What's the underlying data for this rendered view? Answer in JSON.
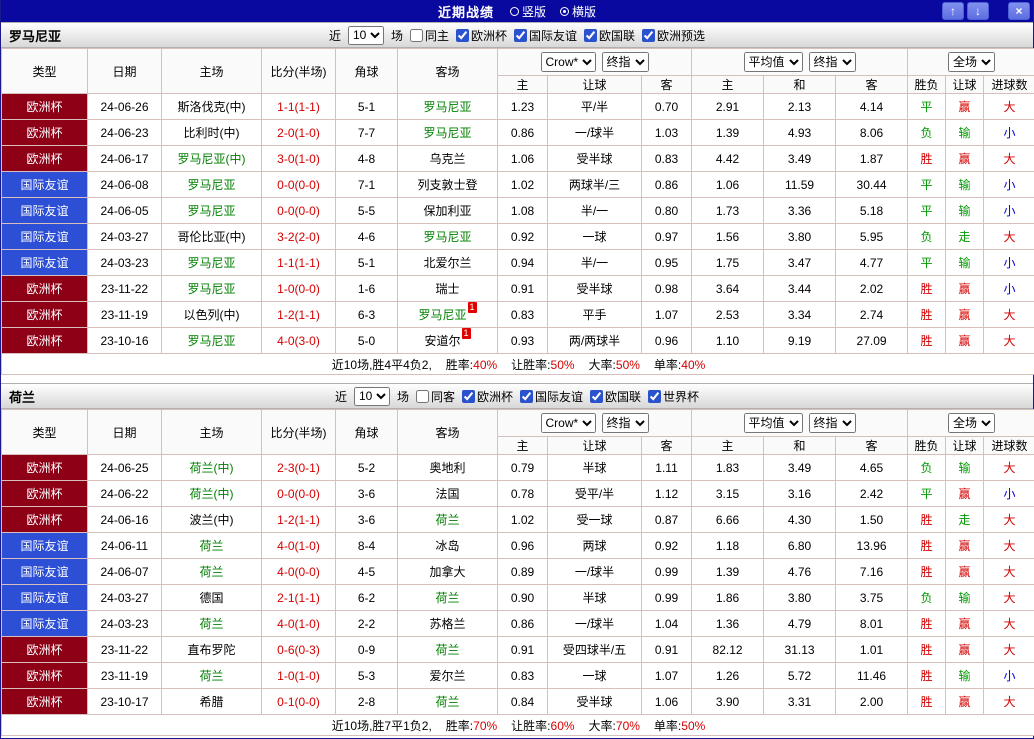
{
  "titlebar": {
    "title": "近期战绩",
    "radios": [
      {
        "label": "竖版",
        "selected": false
      },
      {
        "label": "横版",
        "selected": true
      }
    ],
    "buttons": {
      "up": "↑",
      "down": "↓",
      "close": "×"
    }
  },
  "filter_labels": {
    "near": "近",
    "games": "场"
  },
  "table_header": {
    "type": "类型",
    "date": "日期",
    "home": "主场",
    "score": "比分(半场)",
    "corner": "角球",
    "away": "客场",
    "ah_group": {
      "select1": "Crow*",
      "select2": "终指",
      "home": "主",
      "line": "让球",
      "away": "客"
    },
    "eu_group": {
      "select1": "平均值",
      "select2": "终指",
      "home": "主",
      "draw": "和",
      "away": "客"
    },
    "result_group": {
      "select": "全场",
      "wdl": "胜负",
      "handicap": "让球",
      "goals": "进球数"
    }
  },
  "colors": {
    "titlebar-bg": "#0909a0",
    "euro-bg": "#8d0016",
    "friendly-bg": "#2d4fd5",
    "focus-team": "#008000",
    "score-red": "#d40000",
    "result-red": "#d40000",
    "result-green": "#009900",
    "result-blue": "#0000d0",
    "grid-line": "#d9bebe",
    "button-bg": "#8090ee"
  },
  "sections": [
    {
      "team": "罗马尼亚",
      "filter": {
        "count": "10",
        "same_label": "同主",
        "same_checked": false,
        "competitions": [
          {
            "label": "欧洲杯",
            "checked": true
          },
          {
            "label": "国际友谊",
            "checked": true
          },
          {
            "label": "欧国联",
            "checked": true
          },
          {
            "label": "欧洲预选",
            "checked": true
          }
        ]
      },
      "rows": [
        {
          "type": "欧洲杯",
          "type_class": "euro",
          "date": "24-06-26",
          "home": {
            "name": "斯洛伐克(中)",
            "focus": false
          },
          "score": "1-1(1-1)",
          "corner": "5-1",
          "away": {
            "name": "罗马尼亚",
            "focus": true
          },
          "ah": [
            "1.23",
            "平/半",
            "0.70"
          ],
          "eu": [
            "2.91",
            "2.13",
            "4.14"
          ],
          "results": [
            {
              "t": "平",
              "c": "g"
            },
            {
              "t": "赢",
              "c": "r"
            },
            {
              "t": "大",
              "c": "r"
            }
          ]
        },
        {
          "type": "欧洲杯",
          "type_class": "euro",
          "date": "24-06-23",
          "home": {
            "name": "比利时(中)",
            "focus": false
          },
          "score": "2-0(1-0)",
          "corner": "7-7",
          "away": {
            "name": "罗马尼亚",
            "focus": true
          },
          "ah": [
            "0.86",
            "一/球半",
            "1.03"
          ],
          "eu": [
            "1.39",
            "4.93",
            "8.06"
          ],
          "results": [
            {
              "t": "负",
              "c": "g"
            },
            {
              "t": "输",
              "c": "g"
            },
            {
              "t": "小",
              "c": "b"
            }
          ]
        },
        {
          "type": "欧洲杯",
          "type_class": "euro",
          "date": "24-06-17",
          "home": {
            "name": "罗马尼亚(中)",
            "focus": true
          },
          "score": "3-0(1-0)",
          "corner": "4-8",
          "away": {
            "name": "乌克兰",
            "focus": false
          },
          "ah": [
            "1.06",
            "受半球",
            "0.83"
          ],
          "eu": [
            "4.42",
            "3.49",
            "1.87"
          ],
          "results": [
            {
              "t": "胜",
              "c": "r"
            },
            {
              "t": "赢",
              "c": "r"
            },
            {
              "t": "大",
              "c": "r"
            }
          ]
        },
        {
          "type": "国际友谊",
          "type_class": "friendly",
          "date": "24-06-08",
          "home": {
            "name": "罗马尼亚",
            "focus": true
          },
          "score": "0-0(0-0)",
          "corner": "7-1",
          "away": {
            "name": "列支敦士登",
            "focus": false
          },
          "ah": [
            "1.02",
            "两球半/三",
            "0.86"
          ],
          "eu": [
            "1.06",
            "11.59",
            "30.44"
          ],
          "results": [
            {
              "t": "平",
              "c": "g"
            },
            {
              "t": "输",
              "c": "g"
            },
            {
              "t": "小",
              "c": "b"
            }
          ]
        },
        {
          "type": "国际友谊",
          "type_class": "friendly",
          "date": "24-06-05",
          "home": {
            "name": "罗马尼亚",
            "focus": true
          },
          "score": "0-0(0-0)",
          "corner": "5-5",
          "away": {
            "name": "保加利亚",
            "focus": false
          },
          "ah": [
            "1.08",
            "半/一",
            "0.80"
          ],
          "eu": [
            "1.73",
            "3.36",
            "5.18"
          ],
          "results": [
            {
              "t": "平",
              "c": "g"
            },
            {
              "t": "输",
              "c": "g"
            },
            {
              "t": "小",
              "c": "b"
            }
          ]
        },
        {
          "type": "国际友谊",
          "type_class": "friendly",
          "date": "24-03-27",
          "home": {
            "name": "哥伦比亚(中)",
            "focus": false
          },
          "score": "3-2(2-0)",
          "corner": "4-6",
          "away": {
            "name": "罗马尼亚",
            "focus": true
          },
          "ah": [
            "0.92",
            "一球",
            "0.97"
          ],
          "eu": [
            "1.56",
            "3.80",
            "5.95"
          ],
          "results": [
            {
              "t": "负",
              "c": "g"
            },
            {
              "t": "走",
              "c": "g"
            },
            {
              "t": "大",
              "c": "r"
            }
          ]
        },
        {
          "type": "国际友谊",
          "type_class": "friendly",
          "date": "24-03-23",
          "home": {
            "name": "罗马尼亚",
            "focus": true
          },
          "score": "1-1(1-1)",
          "corner": "5-1",
          "away": {
            "name": "北爱尔兰",
            "focus": false
          },
          "ah": [
            "0.94",
            "半/一",
            "0.95"
          ],
          "eu": [
            "1.75",
            "3.47",
            "4.77"
          ],
          "results": [
            {
              "t": "平",
              "c": "g"
            },
            {
              "t": "输",
              "c": "g"
            },
            {
              "t": "小",
              "c": "b"
            }
          ]
        },
        {
          "type": "欧洲杯",
          "type_class": "euro",
          "date": "23-11-22",
          "home": {
            "name": "罗马尼亚",
            "focus": true
          },
          "score": "1-0(0-0)",
          "corner": "1-6",
          "away": {
            "name": "瑞士",
            "focus": false
          },
          "ah": [
            "0.91",
            "受半球",
            "0.98"
          ],
          "eu": [
            "3.64",
            "3.44",
            "2.02"
          ],
          "results": [
            {
              "t": "胜",
              "c": "r"
            },
            {
              "t": "赢",
              "c": "r"
            },
            {
              "t": "小",
              "c": "b"
            }
          ]
        },
        {
          "type": "欧洲杯",
          "type_class": "euro",
          "date": "23-11-19",
          "home": {
            "name": "以色列(中)",
            "focus": false
          },
          "score": "1-2(1-1)",
          "corner": "6-3",
          "away": {
            "name": "罗马尼亚",
            "focus": true,
            "badge": "1"
          },
          "ah": [
            "0.83",
            "平手",
            "1.07"
          ],
          "eu": [
            "2.53",
            "3.34",
            "2.74"
          ],
          "results": [
            {
              "t": "胜",
              "c": "r"
            },
            {
              "t": "赢",
              "c": "r"
            },
            {
              "t": "大",
              "c": "r"
            }
          ]
        },
        {
          "type": "欧洲杯",
          "type_class": "euro",
          "date": "23-10-16",
          "home": {
            "name": "罗马尼亚",
            "focus": true
          },
          "score": "4-0(3-0)",
          "corner": "5-0",
          "away": {
            "name": "安道尔",
            "focus": false,
            "badge": "1"
          },
          "ah": [
            "0.93",
            "两/两球半",
            "0.96"
          ],
          "eu": [
            "1.10",
            "9.19",
            "27.09"
          ],
          "results": [
            {
              "t": "胜",
              "c": "r"
            },
            {
              "t": "赢",
              "c": "r"
            },
            {
              "t": "大",
              "c": "r"
            }
          ]
        }
      ],
      "summary_prefix": "近10场,胜4平4负2,",
      "summary_stats": [
        {
          "label": "胜率:",
          "value": "40%"
        },
        {
          "label": "让胜率:",
          "value": "50%"
        },
        {
          "label": "大率:",
          "value": "50%"
        },
        {
          "label": "单率:",
          "value": "40%"
        }
      ]
    },
    {
      "team": "荷兰",
      "filter": {
        "count": "10",
        "same_label": "同客",
        "same_checked": false,
        "competitions": [
          {
            "label": "欧洲杯",
            "checked": true
          },
          {
            "label": "国际友谊",
            "checked": true
          },
          {
            "label": "欧国联",
            "checked": true
          },
          {
            "label": "世界杯",
            "checked": true
          }
        ]
      },
      "rows": [
        {
          "type": "欧洲杯",
          "type_class": "euro",
          "date": "24-06-25",
          "home": {
            "name": "荷兰(中)",
            "focus": true
          },
          "score": "2-3(0-1)",
          "corner": "5-2",
          "away": {
            "name": "奥地利",
            "focus": false
          },
          "ah": [
            "0.79",
            "半球",
            "1.11"
          ],
          "eu": [
            "1.83",
            "3.49",
            "4.65"
          ],
          "results": [
            {
              "t": "负",
              "c": "g"
            },
            {
              "t": "输",
              "c": "g"
            },
            {
              "t": "大",
              "c": "r"
            }
          ]
        },
        {
          "type": "欧洲杯",
          "type_class": "euro",
          "date": "24-06-22",
          "home": {
            "name": "荷兰(中)",
            "focus": true
          },
          "score": "0-0(0-0)",
          "corner": "3-6",
          "away": {
            "name": "法国",
            "focus": false
          },
          "ah": [
            "0.78",
            "受平/半",
            "1.12"
          ],
          "eu": [
            "3.15",
            "3.16",
            "2.42"
          ],
          "results": [
            {
              "t": "平",
              "c": "g"
            },
            {
              "t": "赢",
              "c": "r"
            },
            {
              "t": "小",
              "c": "b"
            }
          ]
        },
        {
          "type": "欧洲杯",
          "type_class": "euro",
          "date": "24-06-16",
          "home": {
            "name": "波兰(中)",
            "focus": false
          },
          "score": "1-2(1-1)",
          "corner": "3-6",
          "away": {
            "name": "荷兰",
            "focus": true
          },
          "ah": [
            "1.02",
            "受一球",
            "0.87"
          ],
          "eu": [
            "6.66",
            "4.30",
            "1.50"
          ],
          "results": [
            {
              "t": "胜",
              "c": "r"
            },
            {
              "t": "走",
              "c": "g"
            },
            {
              "t": "大",
              "c": "r"
            }
          ]
        },
        {
          "type": "国际友谊",
          "type_class": "friendly",
          "date": "24-06-11",
          "home": {
            "name": "荷兰",
            "focus": true
          },
          "score": "4-0(1-0)",
          "corner": "8-4",
          "away": {
            "name": "冰岛",
            "focus": false
          },
          "ah": [
            "0.96",
            "两球",
            "0.92"
          ],
          "eu": [
            "1.18",
            "6.80",
            "13.96"
          ],
          "results": [
            {
              "t": "胜",
              "c": "r"
            },
            {
              "t": "赢",
              "c": "r"
            },
            {
              "t": "大",
              "c": "r"
            }
          ]
        },
        {
          "type": "国际友谊",
          "type_class": "friendly",
          "date": "24-06-07",
          "home": {
            "name": "荷兰",
            "focus": true
          },
          "score": "4-0(0-0)",
          "corner": "4-5",
          "away": {
            "name": "加拿大",
            "focus": false
          },
          "ah": [
            "0.89",
            "一/球半",
            "0.99"
          ],
          "eu": [
            "1.39",
            "4.76",
            "7.16"
          ],
          "results": [
            {
              "t": "胜",
              "c": "r"
            },
            {
              "t": "赢",
              "c": "r"
            },
            {
              "t": "大",
              "c": "r"
            }
          ]
        },
        {
          "type": "国际友谊",
          "type_class": "friendly",
          "date": "24-03-27",
          "home": {
            "name": "德国",
            "focus": false
          },
          "score": "2-1(1-1)",
          "corner": "6-2",
          "away": {
            "name": "荷兰",
            "focus": true
          },
          "ah": [
            "0.90",
            "半球",
            "0.99"
          ],
          "eu": [
            "1.86",
            "3.80",
            "3.75"
          ],
          "results": [
            {
              "t": "负",
              "c": "g"
            },
            {
              "t": "输",
              "c": "g"
            },
            {
              "t": "大",
              "c": "r"
            }
          ]
        },
        {
          "type": "国际友谊",
          "type_class": "friendly",
          "date": "24-03-23",
          "home": {
            "name": "荷兰",
            "focus": true
          },
          "score": "4-0(1-0)",
          "corner": "2-2",
          "away": {
            "name": "苏格兰",
            "focus": false
          },
          "ah": [
            "0.86",
            "一/球半",
            "1.04"
          ],
          "eu": [
            "1.36",
            "4.79",
            "8.01"
          ],
          "results": [
            {
              "t": "胜",
              "c": "r"
            },
            {
              "t": "赢",
              "c": "r"
            },
            {
              "t": "大",
              "c": "r"
            }
          ]
        },
        {
          "type": "欧洲杯",
          "type_class": "euro",
          "date": "23-11-22",
          "home": {
            "name": "直布罗陀",
            "focus": false
          },
          "score": "0-6(0-3)",
          "corner": "0-9",
          "away": {
            "name": "荷兰",
            "focus": true
          },
          "ah": [
            "0.91",
            "受四球半/五",
            "0.91"
          ],
          "eu": [
            "82.12",
            "31.13",
            "1.01"
          ],
          "results": [
            {
              "t": "胜",
              "c": "r"
            },
            {
              "t": "赢",
              "c": "r"
            },
            {
              "t": "大",
              "c": "r"
            }
          ]
        },
        {
          "type": "欧洲杯",
          "type_class": "euro",
          "date": "23-11-19",
          "home": {
            "name": "荷兰",
            "focus": true
          },
          "score": "1-0(1-0)",
          "corner": "5-3",
          "away": {
            "name": "爱尔兰",
            "focus": false
          },
          "ah": [
            "0.83",
            "一球",
            "1.07"
          ],
          "eu": [
            "1.26",
            "5.72",
            "11.46"
          ],
          "results": [
            {
              "t": "胜",
              "c": "r"
            },
            {
              "t": "输",
              "c": "g"
            },
            {
              "t": "小",
              "c": "b"
            }
          ]
        },
        {
          "type": "欧洲杯",
          "type_class": "euro",
          "date": "23-10-17",
          "home": {
            "name": "希腊",
            "focus": false
          },
          "score": "0-1(0-0)",
          "corner": "2-8",
          "away": {
            "name": "荷兰",
            "focus": true
          },
          "ah": [
            "0.84",
            "受半球",
            "1.06"
          ],
          "eu": [
            "3.90",
            "3.31",
            "2.00"
          ],
          "results": [
            {
              "t": "胜",
              "c": "r"
            },
            {
              "t": "赢",
              "c": "r"
            },
            {
              "t": "大",
              "c": "r"
            }
          ]
        }
      ],
      "summary_prefix": "近10场,胜7平1负2,",
      "summary_stats": [
        {
          "label": "胜率:",
          "value": "70%"
        },
        {
          "label": "让胜率:",
          "value": "60%"
        },
        {
          "label": "大率:",
          "value": "70%"
        },
        {
          "label": "单率:",
          "value": "50%"
        }
      ]
    }
  ]
}
